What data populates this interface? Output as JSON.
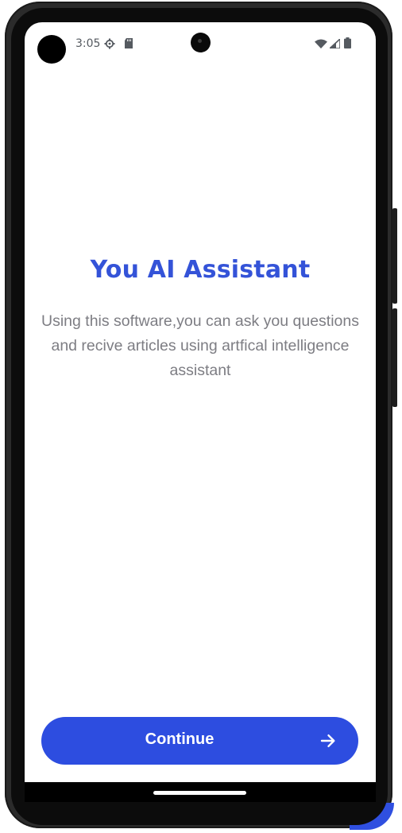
{
  "status_bar": {
    "time": "3:05",
    "icons": [
      "camera-cutout",
      "settings-gear-icon",
      "sd-card-icon",
      "wifi-icon",
      "signal-icon",
      "battery-icon"
    ]
  },
  "onboarding": {
    "title": "You AI Assistant",
    "description": "Using this software,you can ask you questions and recive articles using artfical intelligence assistant",
    "continue_button": {
      "label": "Continue",
      "icon": "arrow-right-icon"
    }
  },
  "colors": {
    "accent": "#2d4de0",
    "title": "#3453d8",
    "body_text": "#7d7d83",
    "background": "#ffffff"
  }
}
